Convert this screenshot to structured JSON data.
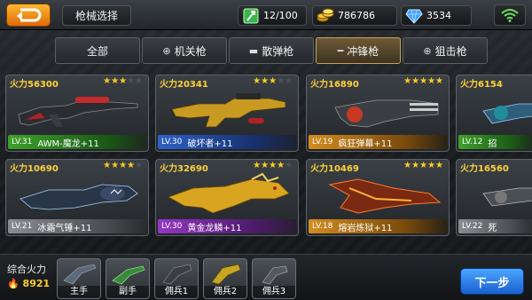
{
  "header": {
    "title": "枪械选择",
    "energy": "12/100",
    "gold": "786786",
    "diamond": "3534"
  },
  "tabs": [
    {
      "label": "全部",
      "icon": ""
    },
    {
      "label": "机关枪",
      "icon": "crosshair-icon"
    },
    {
      "label": "散弹枪",
      "icon": "shotgun-icon"
    },
    {
      "label": "冲锋枪",
      "icon": "smg-icon",
      "active": true
    },
    {
      "label": "狙击枪",
      "icon": "scope-icon"
    }
  ],
  "weapons": [
    {
      "power": "火力56300",
      "stars": 3,
      "level": "LV.31",
      "name": "AWM-魔龙+11",
      "rarity": "green"
    },
    {
      "power": "火力20341",
      "stars": 3,
      "level": "LV.30",
      "name": "破坏者+11",
      "rarity": "blue"
    },
    {
      "power": "火力16890",
      "stars": 5,
      "level": "LV.19",
      "name": "疯狂弹幕+11",
      "rarity": "orange"
    },
    {
      "power": "火力6154",
      "stars": 0,
      "level": "LV.12",
      "name": "招",
      "rarity": "green"
    },
    {
      "power": "火力10690",
      "stars": 4,
      "level": "LV.21",
      "name": "冰霜气锤+11",
      "rarity": "gray"
    },
    {
      "power": "火力32690",
      "stars": 4,
      "level": "LV.30",
      "name": "黄金龙鳞+11",
      "rarity": "purple"
    },
    {
      "power": "火力10469",
      "stars": 5,
      "level": "LV.18",
      "name": "熔岩炼狱+11",
      "rarity": "orange"
    },
    {
      "power": "火力16560",
      "stars": 0,
      "level": "LV.22",
      "name": "死",
      "rarity": "gray"
    }
  ],
  "bottom": {
    "total_label": "综合火力",
    "total_value": "8921",
    "slots": [
      "主手",
      "副手",
      "佣兵1",
      "佣兵2",
      "佣兵3"
    ],
    "next_label": "下一步"
  },
  "colors": {
    "accent": "#f08a14",
    "star": "#ffcc22",
    "power": "#ffd23a",
    "next_button": "#2f7fe6"
  }
}
